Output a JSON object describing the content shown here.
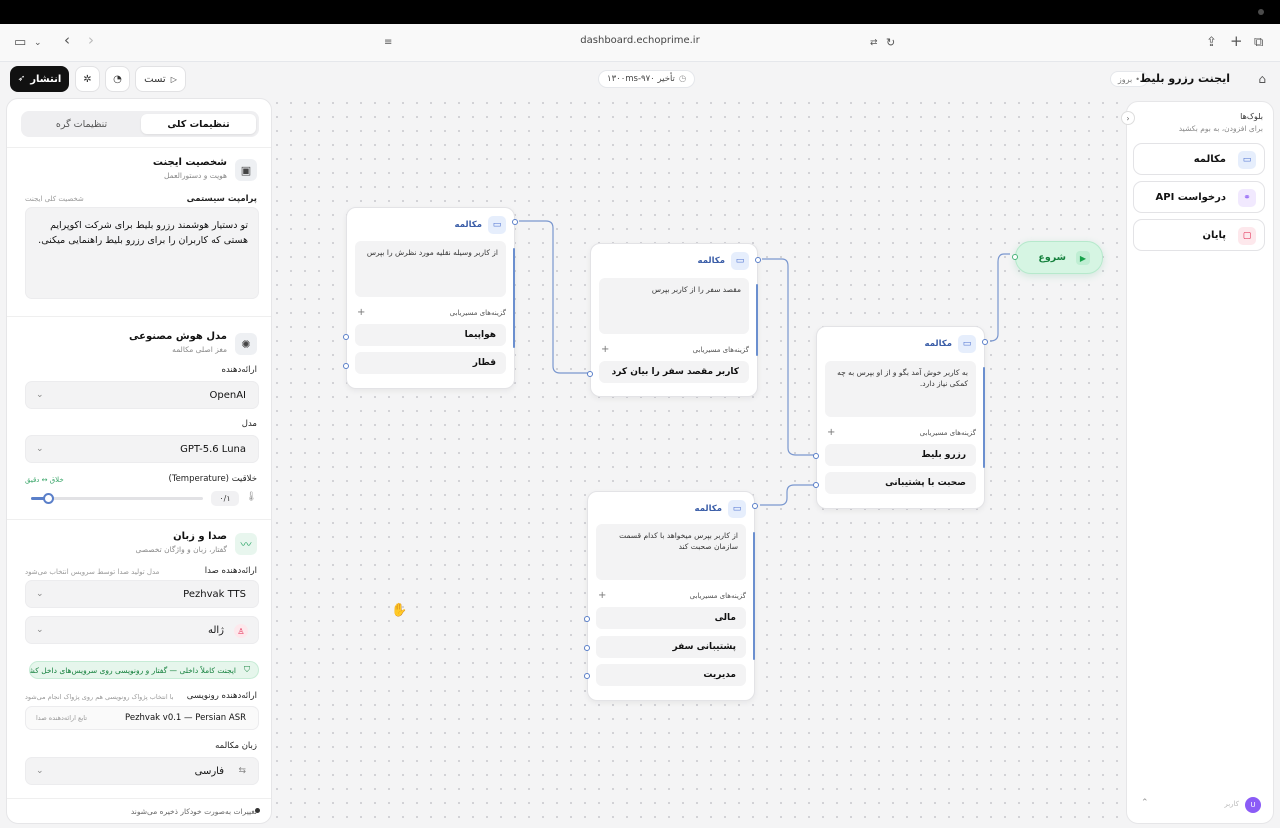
{
  "browser": {
    "url": "dashboard.echoprime.ir"
  },
  "toolbar": {
    "publish_label": "انتشار",
    "test_label": "تست",
    "delay_label": "۱۳۰۰ms-۹۷۰ تأخیر",
    "update_label": "بروز",
    "title": "ایجنت رزرو بلیط"
  },
  "left_panel": {
    "tabs": [
      "تنظیمات کلی",
      "تنظیمات گره"
    ],
    "persona": {
      "title": "شخصیت ایجنت",
      "subtitle": "هویت و دستورالعمل",
      "prompt_label": "پرامپت سیستمی",
      "prompt_hint": "شخصیت کلی ایجنت",
      "prompt_text": "تو دستیار هوشمند رزرو بلیط برای شرکت اکوپرایم هستی که کاربران را برای رزرو بلیط راهنمایی میکنی."
    },
    "ai_model": {
      "title": "مدل هوش مصنوعی",
      "subtitle": "مغز اصلی مکالمه",
      "provider_label": "ارائه‌دهنده",
      "provider_value": "OpenAI",
      "model_label": "مدل",
      "model_value": "GPT-5.6 Luna",
      "temperature_label": "خلاقیت (Temperature)",
      "temperature_hint": "خلاق ↔ دقیق",
      "temperature_value": "۰/۱",
      "temperature_level": 0.1
    },
    "voice": {
      "title": "صدا و زبان",
      "subtitle": "گفتار، زبان و واژگان تخصصی",
      "tts_label": "ارائه‌دهنده صدا",
      "tts_hint": "مدل تولید صدا توسط سرویس انتخاب می‌شود",
      "tts_value": "Pezhvak TTS",
      "voice_value": "ژاله",
      "badge": "ایجنت کاملاً داخلی — گفتار و رونویسی روی سرویس‌های داخل کشور",
      "asr_label": "ارائه‌دهنده رونویسی",
      "asr_hint": "با انتخاب پژواک رونویسی هم روی پژواک انجام می‌شود",
      "asr_value": "Pezhvak v0.1 — Persian ASR",
      "asr_sub": "تابع ارائه‌دهنده صدا",
      "lang_label": "زبان مکالمه",
      "lang_value": "فارسی"
    },
    "footer": "تغییرات به‌صورت خودکار ذخیره می‌شوند"
  },
  "right_panel": {
    "title": "بلوک‌ها",
    "subtitle": "برای افزودن، به بوم بکشید",
    "blocks": [
      {
        "label": "مکالمه",
        "icon": "chat-icon",
        "color": "#4a6fcf",
        "bg": "#e6eefc"
      },
      {
        "label": "درخواست API",
        "icon": "webhook-icon",
        "color": "#8b5cf6",
        "bg": "#f1e9fe"
      },
      {
        "label": "پایان",
        "icon": "stop-icon",
        "color": "#e11d48",
        "bg": "#fde8ec"
      }
    ],
    "user_name": "کاربر",
    "avatar_letter": "U"
  },
  "nodes": {
    "start": {
      "label": "شروع"
    },
    "n1": {
      "title": "مکالمه",
      "prompt": "به کاربر خوش آمد بگو و از او بپرس به چه کمکی نیاز دارد.",
      "routes_label": "گزینه‌های مسیریابی",
      "routes": [
        "رزرو بلیط",
        "صحبت با پشتیبانی"
      ]
    },
    "n2": {
      "title": "مکالمه",
      "prompt": "مقصد سفر را از کاربر بپرس",
      "routes_label": "گزینه‌های مسیریابی",
      "routes": [
        "کاربر مقصد سفر را بیان کرد"
      ]
    },
    "n3": {
      "title": "مکالمه",
      "prompt": "از کاربر وسیله نقلیه مورد نظرش را بپرس",
      "routes_label": "گزینه‌های مسیریابی",
      "routes": [
        "هواپیما",
        "قطار"
      ]
    },
    "n4": {
      "title": "مکالمه",
      "prompt": "از کاربر بپرس میخواهد با کدام قسمت سازمان صحبت کند",
      "routes_label": "گزینه‌های مسیریابی",
      "routes": [
        "مالی",
        "پشتیبانی سفر",
        "مدیریت"
      ]
    }
  }
}
